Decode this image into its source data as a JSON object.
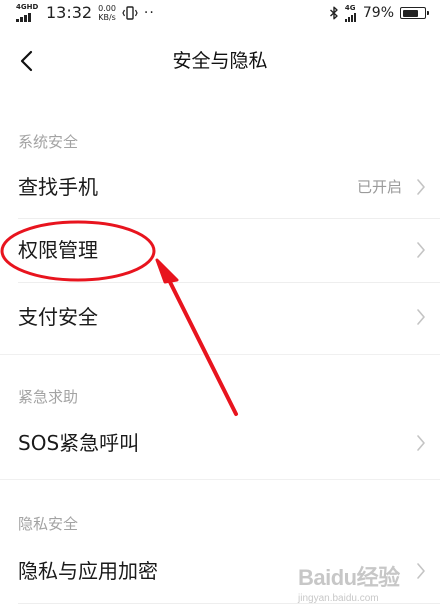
{
  "status_bar": {
    "network_label": "4GHD",
    "time": "13:32",
    "speed_value": "0.00",
    "speed_unit": "KB/s",
    "more_dots": "··",
    "network2_label": "4G",
    "battery_percent": "79%",
    "battery_level": 0.79,
    "icons": [
      "signal-icon",
      "vibrate-icon",
      "bluetooth-icon",
      "battery-icon"
    ]
  },
  "header": {
    "back_icon": "chevron-left-icon",
    "title": "安全与隐私"
  },
  "sections": [
    {
      "label": "系统安全",
      "items": [
        {
          "label": "查找手机",
          "value": "已开启"
        },
        {
          "label": "权限管理",
          "value": ""
        },
        {
          "label": "支付安全",
          "value": ""
        }
      ]
    },
    {
      "label": "紧急求助",
      "items": [
        {
          "label": "SOS紧急呼叫",
          "value": ""
        }
      ]
    },
    {
      "label": "隐私安全",
      "items": [
        {
          "label": "隐私与应用加密",
          "value": ""
        }
      ]
    }
  ],
  "annotation": {
    "highlight_color": "#e8141e",
    "shapes": [
      "highlight-ellipse",
      "pointer-arrow"
    ]
  },
  "watermark": {
    "main": "Baidu经验",
    "sub": "jingyan.baidu.com"
  }
}
